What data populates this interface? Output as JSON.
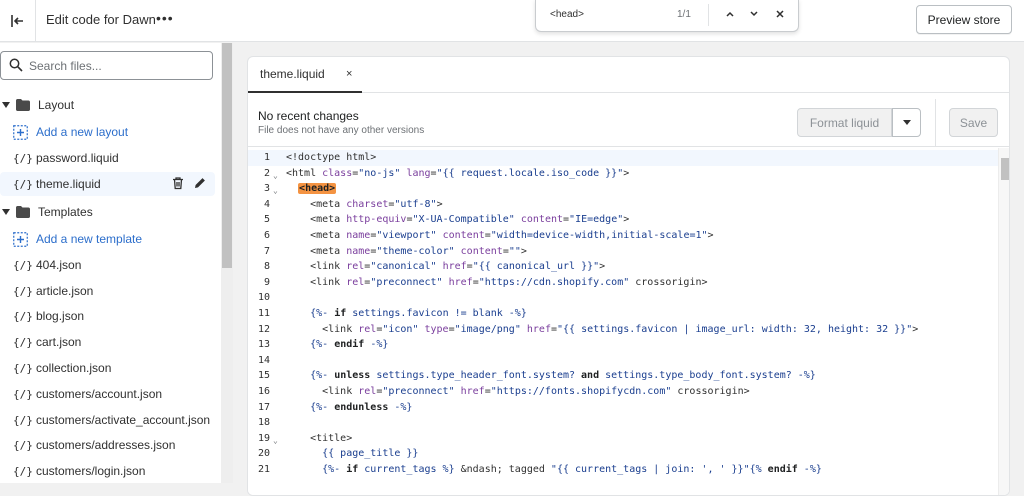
{
  "topbar": {
    "exit_icon": "exit-icon",
    "title": "Edit code for Dawn",
    "more": "•••",
    "search_query": "<head>",
    "search_count": "1/1",
    "preview_label": "Preview store"
  },
  "sidebar": {
    "search_placeholder": "Search files...",
    "layout_folder": "Layout",
    "add_layout": "Add a new layout",
    "layout_files": [
      "password.liquid",
      "theme.liquid"
    ],
    "templates_folder": "Templates",
    "add_template": "Add a new template",
    "template_files": [
      "404.json",
      "article.json",
      "blog.json",
      "cart.json",
      "collection.json",
      "customers/account.json",
      "customers/activate_account.json",
      "customers/addresses.json",
      "customers/login.json"
    ],
    "file_glyph": "{/}"
  },
  "editor": {
    "tab_label": "theme.liquid",
    "tab_close": "×",
    "status_title": "No recent changes",
    "status_sub": "File does not have any other versions",
    "format_label": "Format liquid",
    "save_label": "Save"
  },
  "code_lines": [
    "<!doctype html>",
    "<html class=\"no-js\" lang=\"{{ request.locale.iso_code }}\">",
    "  <head>",
    "    <meta charset=\"utf-8\">",
    "    <meta http-equiv=\"X-UA-Compatible\" content=\"IE=edge\">",
    "    <meta name=\"viewport\" content=\"width=device-width,initial-scale=1\">",
    "    <meta name=\"theme-color\" content=\"\">",
    "    <link rel=\"canonical\" href=\"{{ canonical_url }}\">",
    "    <link rel=\"preconnect\" href=\"https://cdn.shopify.com\" crossorigin>",
    "",
    "    {%- if settings.favicon != blank -%}",
    "      <link rel=\"icon\" type=\"image/png\" href=\"{{ settings.favicon | image_url: width: 32, height: 32 }}\">",
    "    {%- endif -%}",
    "",
    "    {%- unless settings.type_header_font.system? and settings.type_body_font.system? -%}",
    "      <link rel=\"preconnect\" href=\"https://fonts.shopifycdn.com\" crossorigin>",
    "    {%- endunless -%}",
    "",
    "    <title>",
    "      {{ page_title }}",
    "      {%- if current_tags %} &ndash; tagged \"{{ current_tags | join: ', ' }}\"{% endif -%}"
  ],
  "colors": {
    "accent": "#2c6ecb",
    "highlight": "#f49342",
    "active_row": "#f2f7fe"
  }
}
